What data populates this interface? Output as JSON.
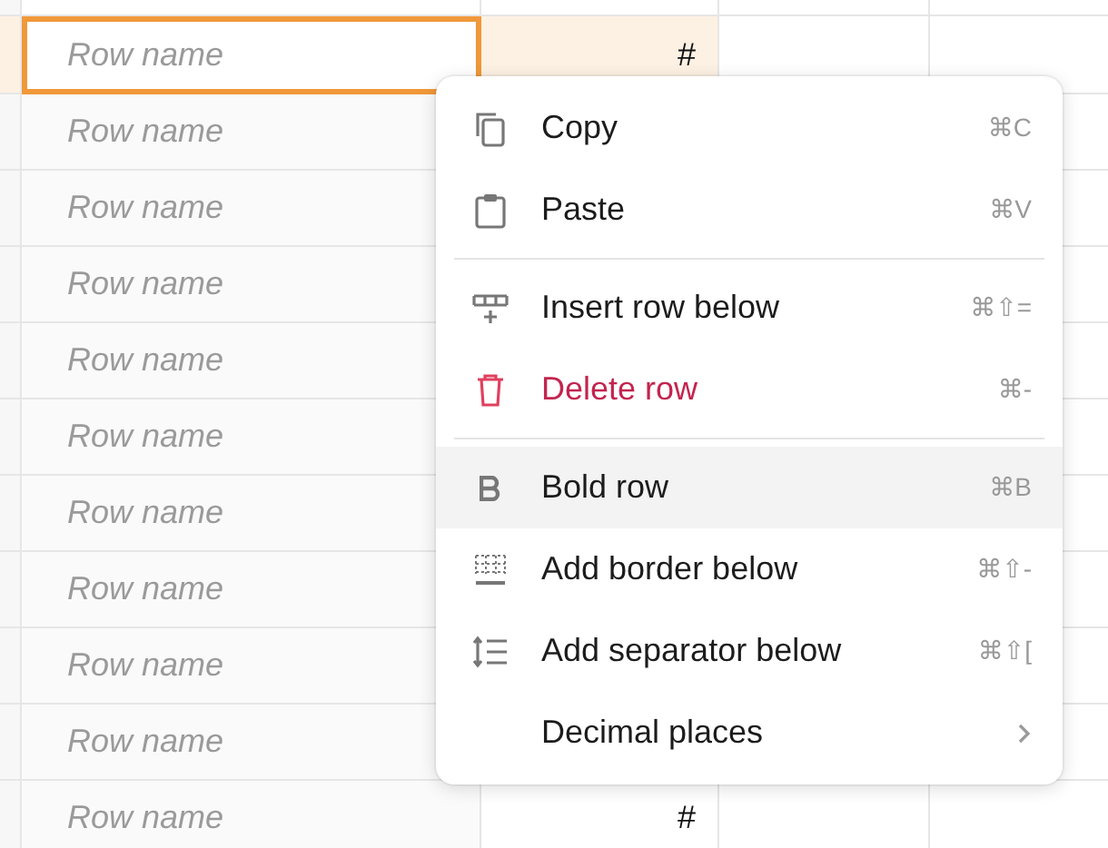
{
  "table": {
    "rows": [
      {
        "name_placeholder": "Row name",
        "value": "#",
        "selected": true
      },
      {
        "name_placeholder": "Row name",
        "selected": false
      },
      {
        "name_placeholder": "Row name",
        "selected": false
      },
      {
        "name_placeholder": "Row name",
        "selected": false
      },
      {
        "name_placeholder": "Row name",
        "selected": false
      },
      {
        "name_placeholder": "Row name",
        "selected": false
      },
      {
        "name_placeholder": "Row name",
        "selected": false
      },
      {
        "name_placeholder": "Row name",
        "selected": false
      },
      {
        "name_placeholder": "Row name",
        "selected": false
      },
      {
        "name_placeholder": "Row name",
        "selected": false
      },
      {
        "name_placeholder": "Row name",
        "value": "#",
        "selected": false
      }
    ]
  },
  "context_menu": {
    "items": [
      {
        "kind": "item",
        "label": "Copy",
        "shortcut": "⌘C",
        "destructive": false,
        "highlighted": false
      },
      {
        "kind": "item",
        "label": "Paste",
        "shortcut": "⌘V",
        "destructive": false,
        "highlighted": false
      },
      {
        "kind": "divider"
      },
      {
        "kind": "item",
        "label": "Insert row below",
        "shortcut": "⌘⇧=",
        "destructive": false,
        "highlighted": false
      },
      {
        "kind": "item",
        "label": "Delete row",
        "shortcut": "⌘-",
        "destructive": true,
        "highlighted": false
      },
      {
        "kind": "divider"
      },
      {
        "kind": "item",
        "label": "Bold row",
        "shortcut": "⌘B",
        "destructive": false,
        "highlighted": true
      },
      {
        "kind": "item",
        "label": "Add border below",
        "shortcut": "⌘⇧-",
        "destructive": false,
        "highlighted": false
      },
      {
        "kind": "item",
        "label": "Add separator below",
        "shortcut": "⌘⇧[",
        "destructive": false,
        "highlighted": false
      },
      {
        "kind": "submenu",
        "label": "Decimal places",
        "destructive": false,
        "highlighted": false
      }
    ]
  }
}
